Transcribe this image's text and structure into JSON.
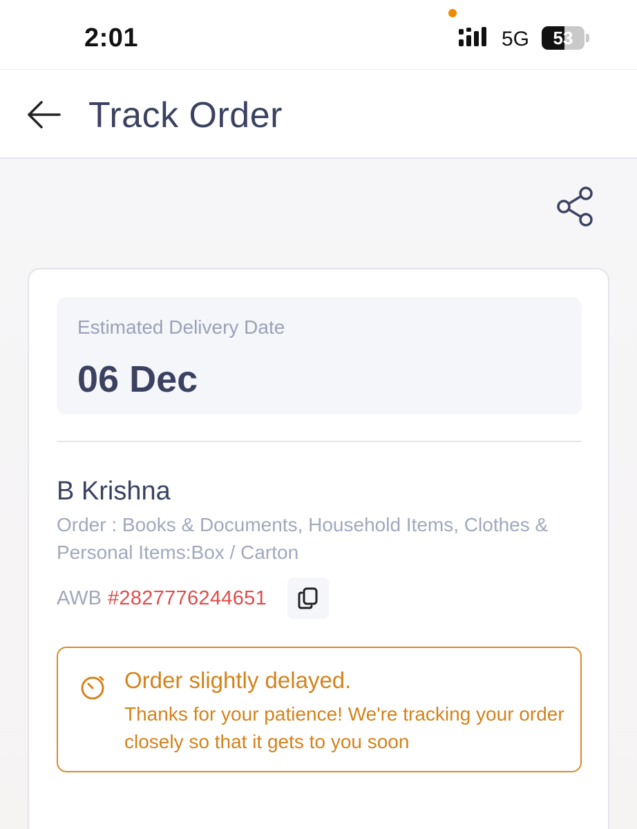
{
  "status_bar": {
    "time": "2:01",
    "network": "5G",
    "battery": "53",
    "battery_level": 0.53
  },
  "header": {
    "title": "Track Order",
    "back_icon": "arrow-left-icon"
  },
  "actions": {
    "share_icon": "share-icon"
  },
  "delivery": {
    "label": "Estimated Delivery Date",
    "date": "06 Dec"
  },
  "order": {
    "customer_name": "B Krishna",
    "items": "Order : Books & Documents, Household Items, Clothes & Personal Items:Box / Carton",
    "awb_label": "AWB",
    "awb_number": "#2827776244651",
    "copy_icon": "copy-icon"
  },
  "alert": {
    "icon": "timer-icon",
    "title": "Order slightly delayed.",
    "message": "Thanks for your patience! We're tracking your order closely so that it gets to you soon"
  },
  "colors": {
    "primary_text": "#3b4261",
    "muted_text": "#a2a7bd",
    "awb_red": "#e14b4b",
    "alert_orange": "#d4821b",
    "status_dot": "#f08a00"
  }
}
